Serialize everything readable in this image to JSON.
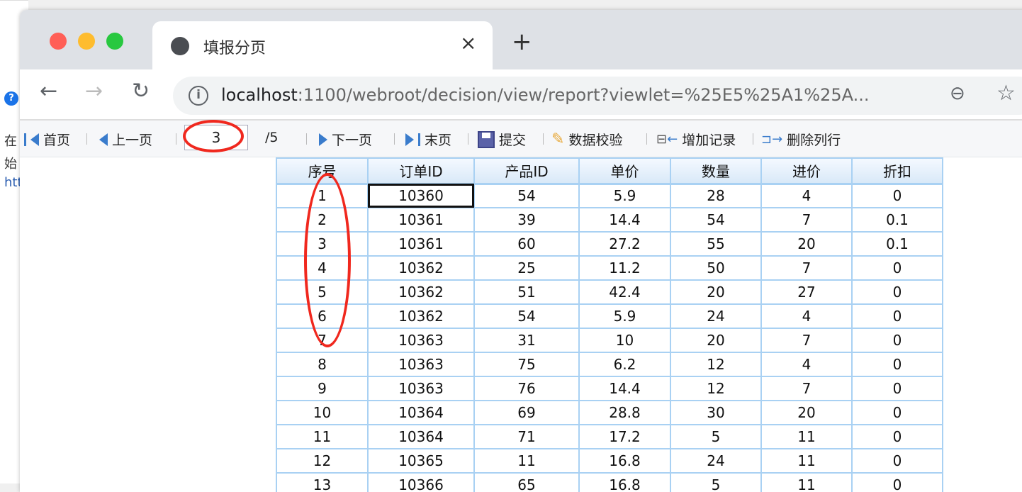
{
  "background_window": {
    "lines": [
      "在",
      "始",
      "htt"
    ],
    "help_icon": "?"
  },
  "browser": {
    "tab_title": "填报分页",
    "close_icon": "×",
    "new_tab_icon": "+",
    "url_host": "localhost",
    "url_rest": ":1100/webroot/decision/view/report?viewlet=%25E5%25A1%25A...",
    "colors": {
      "close": "#ff5f57",
      "minimize": "#febc2e",
      "maximize": "#28c840"
    }
  },
  "toolbar": {
    "first": "首页",
    "prev": "上一页",
    "page_value": "3",
    "page_total": "/5",
    "next": "下一页",
    "last": "末页",
    "submit": "提交",
    "validate": "数据校验",
    "add_record": "增加记录",
    "delete_row": "删除列行"
  },
  "table": {
    "headers": [
      "序号",
      "订单ID",
      "产品ID",
      "单价",
      "数量",
      "进价",
      "折扣"
    ],
    "rows": [
      [
        "1",
        "10360",
        "54",
        "5.9",
        "28",
        "4",
        "0"
      ],
      [
        "2",
        "10361",
        "39",
        "14.4",
        "54",
        "7",
        "0.1"
      ],
      [
        "3",
        "10361",
        "60",
        "27.2",
        "55",
        "20",
        "0.1"
      ],
      [
        "4",
        "10362",
        "25",
        "11.2",
        "50",
        "7",
        "0"
      ],
      [
        "5",
        "10362",
        "51",
        "42.4",
        "20",
        "27",
        "0"
      ],
      [
        "6",
        "10362",
        "54",
        "5.9",
        "24",
        "4",
        "0"
      ],
      [
        "7",
        "10363",
        "31",
        "10",
        "20",
        "7",
        "0"
      ],
      [
        "8",
        "10363",
        "75",
        "6.2",
        "12",
        "4",
        "0"
      ],
      [
        "9",
        "10363",
        "76",
        "14.4",
        "12",
        "7",
        "0"
      ],
      [
        "10",
        "10364",
        "69",
        "28.8",
        "30",
        "20",
        "0"
      ],
      [
        "11",
        "10364",
        "71",
        "17.2",
        "5",
        "11",
        "0"
      ],
      [
        "12",
        "10365",
        "11",
        "16.8",
        "24",
        "11",
        "0"
      ],
      [
        "13",
        "10366",
        "65",
        "16.8",
        "5",
        "11",
        "0"
      ]
    ]
  }
}
